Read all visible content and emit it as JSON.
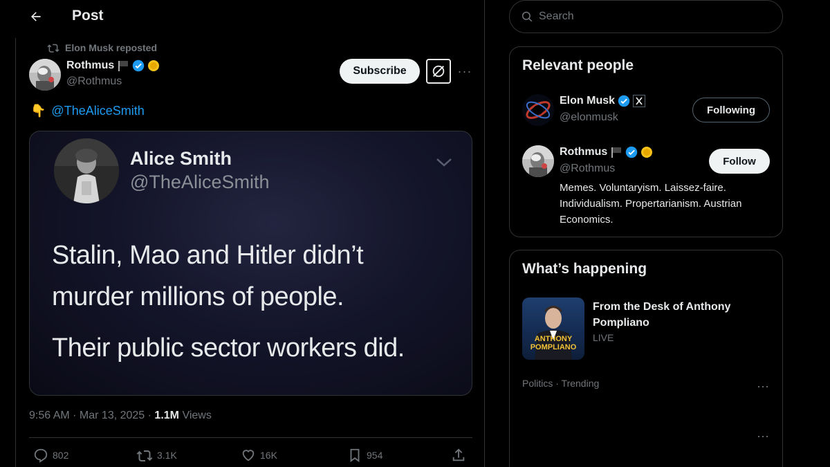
{
  "header": {
    "title": "Post"
  },
  "post": {
    "repost_label": "Elon Musk reposted",
    "author_name": "Rothmus",
    "author_handle": "@Rothmus",
    "subscribe_label": "Subscribe",
    "text_emoji": "👇",
    "text_mention": "@TheAliceSmith",
    "media": {
      "name": "Alice Smith",
      "handle": "@TheAliceSmith",
      "lines": [
        "Stalin, Mao and Hitler didn’t",
        "murder millions of people.",
        "Their public sector workers did."
      ]
    },
    "time": "9:56 AM · Mar 13, 2025 · ",
    "views_count": "1.1M",
    "views_label": " Views",
    "actions": {
      "replies": "802",
      "reposts": "3.1K",
      "likes": "16K",
      "bookmarks": "954"
    }
  },
  "sidebar": {
    "search_placeholder": "Search",
    "relevant": {
      "title": "Relevant people",
      "people": [
        {
          "name": "Elon Musk",
          "handle": "@elonmusk",
          "button": "Following"
        },
        {
          "name": "Rothmus",
          "handle": "@Rothmus",
          "button": "Follow",
          "bio": "Memes. Voluntaryism. Laissez-faire. Individualism. Propertarianism. Austrian Economics."
        }
      ]
    },
    "happening": {
      "title": "What’s happening",
      "trend_title": "From the Desk of Anthony Pompliano",
      "trend_status": "LIVE",
      "thumb_text": "ANTHONY POMPLIANO",
      "category": "Politics · Trending"
    }
  },
  "colors": {
    "accent": "#1d9bf0",
    "verified": "#1d9bf0",
    "gold_badge": "#f6c21a",
    "muted": "#71767b",
    "border": "#2f3336"
  },
  "icons": [
    "back-arrow-icon",
    "repost-icon",
    "verified-icon",
    "flag-icon",
    "gold-badge-icon",
    "grok-icon",
    "more-icon",
    "chevron-down-icon",
    "reply-icon",
    "like-icon",
    "bookmark-icon",
    "share-icon",
    "search-icon",
    "x-affiliate-icon"
  ]
}
